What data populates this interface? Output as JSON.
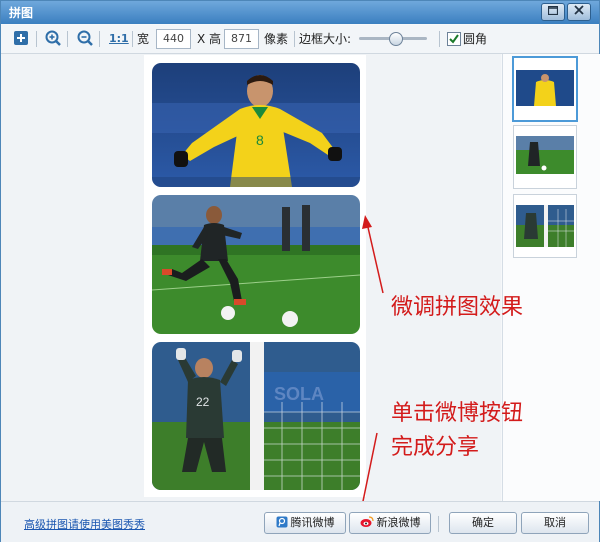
{
  "window": {
    "title": "拼图"
  },
  "toolbar": {
    "zoom_ratio_label": "1:1",
    "width_label": "宽",
    "width_value": "440",
    "height_label": "X 高",
    "height_value": "871",
    "unit_label": "像素",
    "border_label": "边框大小:",
    "border_slider_value": 0.55,
    "rounded_label": "圆角",
    "rounded_checked": true
  },
  "annotations": {
    "fine_tune": "微调拼图效果",
    "share_line1": "单击微博按钮",
    "share_line2": "完成分享"
  },
  "footer": {
    "advanced_link": "高级拼图请使用美图秀秀",
    "tencent_button": "腾讯微博",
    "sina_button": "新浪微博",
    "ok_button": "确定",
    "cancel_button": "取消"
  },
  "colors": {
    "accent": "#3b7fc0",
    "annotation": "#d31b1b"
  }
}
